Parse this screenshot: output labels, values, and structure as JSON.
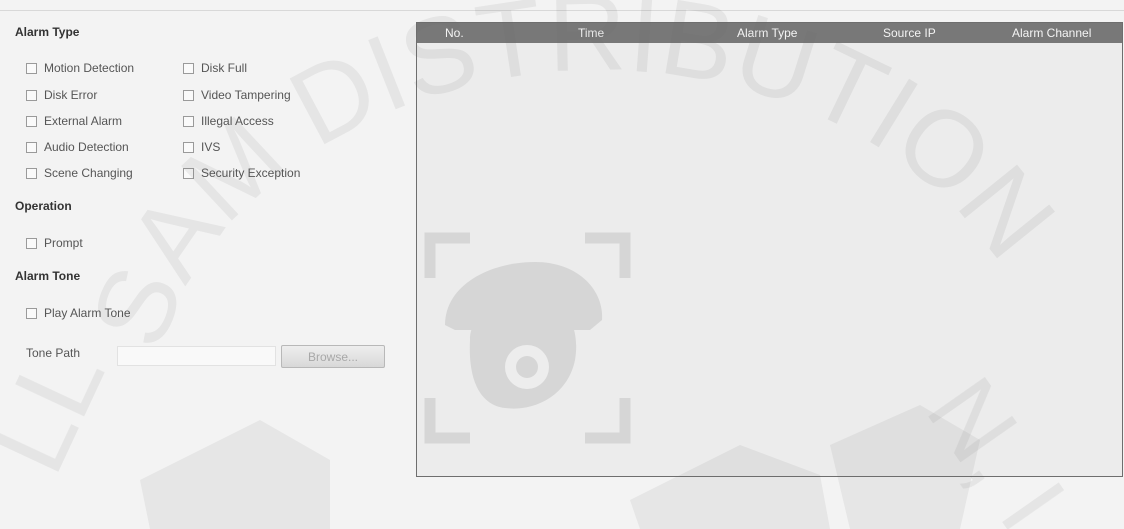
{
  "alarm_type": {
    "title": "Alarm Type",
    "options_left": [
      "Motion Detection",
      "Disk Error",
      "External Alarm",
      "Audio Detection",
      "Scene Changing"
    ],
    "options_right": [
      "Disk Full",
      "Video Tampering",
      "Illegal Access",
      "IVS",
      "Security Exception"
    ]
  },
  "operation": {
    "title": "Operation",
    "prompt_label": "Prompt"
  },
  "alarm_tone": {
    "title": "Alarm Tone",
    "play_label": "Play Alarm Tone",
    "tone_path_label": "Tone Path",
    "tone_path_value": "",
    "browse_label": "Browse..."
  },
  "table": {
    "columns": [
      "No.",
      "Time",
      "Alarm Type",
      "Source IP",
      "Alarm Channel"
    ],
    "rows": []
  },
  "watermark": {
    "text": "SAM DISTRIBUTION",
    "left_fragment": "LL",
    "right_fragment": "N, I"
  },
  "colors": {
    "header_bg": "#787878",
    "panel_border": "#6e6e6e",
    "page_bg": "#f3f3f3"
  }
}
